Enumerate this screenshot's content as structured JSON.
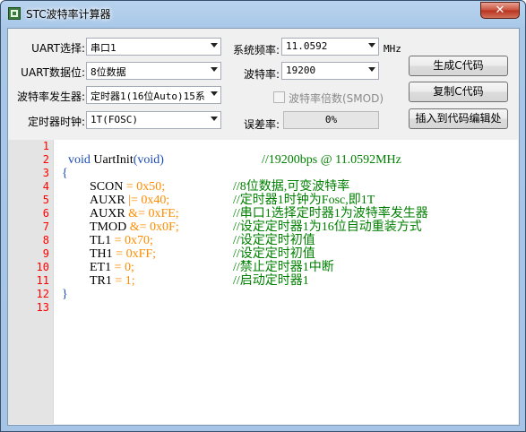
{
  "window": {
    "title": "STC波特率计算器",
    "close_label": "✕"
  },
  "form": {
    "uart_select": {
      "label": "UART选择:",
      "value": "串口1"
    },
    "uart_bits": {
      "label": "UART数据位:",
      "value": "8位数据"
    },
    "baud_gen": {
      "label": "波特率发生器:",
      "value": "定时器1(16位Auto)15系"
    },
    "timer_clock": {
      "label": "定时器时钟:",
      "value": "1T(FOSC)"
    },
    "sys_freq": {
      "label": "系统频率:",
      "value": "11.0592",
      "unit": "MHz"
    },
    "baud_rate": {
      "label": "波特率:",
      "value": "19200"
    },
    "smod": {
      "label": "波特率倍数(SMOD)"
    },
    "error": {
      "label": "误差率:",
      "value": "0%"
    }
  },
  "buttons": {
    "generate": "生成C代码",
    "copy": "复制C代码",
    "insert": "插入到代码编辑处"
  },
  "editor": {
    "line_numbers": [
      "1",
      "2",
      "3",
      "4",
      "5",
      "6",
      "7",
      "8",
      "9",
      "10",
      "11",
      "12",
      "13"
    ],
    "lines": {
      "l2_void": "void",
      "l2_name": "UartInit",
      "l2_paren_open": "(",
      "l2_void2": "void",
      "l2_paren_close": ")",
      "l2_comment": "//19200bps @ 11.0592MHz",
      "l3": "{",
      "l4_id": "SCON",
      "l4_op": "=",
      "l4_val": "0x50;",
      "l4_comment": "//8位数据,可变波特率",
      "l5_id": "AUXR",
      "l5_op": "|=",
      "l5_val": "0x40;",
      "l5_comment": "//定时器1时钟为Fosc,即1T",
      "l6_id": "AUXR",
      "l6_op": "&=",
      "l6_val": "0xFE;",
      "l6_comment": "//串口1选择定时器1为波特率发生器",
      "l7_id": "TMOD",
      "l7_op": "&=",
      "l7_val": "0x0F;",
      "l7_comment": "//设定定时器1为16位自动重装方式",
      "l8_id": "TL1",
      "l8_op": "=",
      "l8_val": "0x70;",
      "l8_comment": "//设定定时初值",
      "l9_id": "TH1",
      "l9_op": "=",
      "l9_val": "0xFF;",
      "l9_comment": "//设定定时初值",
      "l10_id": "ET1",
      "l10_op": "=",
      "l10_val": "0;",
      "l10_comment": "//禁止定时器1中断",
      "l11_id": "TR1",
      "l11_op": "=",
      "l11_val": "1;",
      "l11_comment": "//启动定时器1",
      "l12": "}"
    }
  },
  "colors": {
    "line_number": "#ff0000",
    "keyword": "#1a4ab5",
    "number": "#ff8c00",
    "comment": "#008000"
  }
}
